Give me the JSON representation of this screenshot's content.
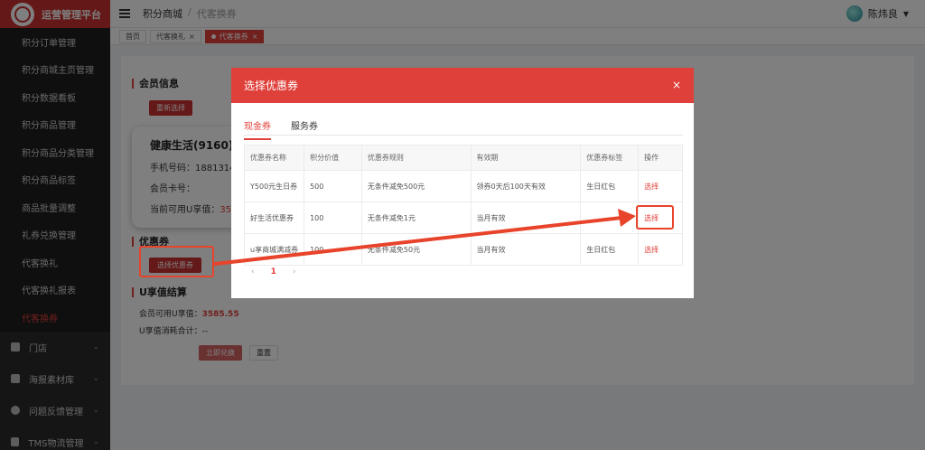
{
  "sidebar": {
    "brand_title": "运营管理平台",
    "items": [
      {
        "label": "积分订单管理"
      },
      {
        "label": "积分商城主页管理"
      },
      {
        "label": "积分数据看板"
      },
      {
        "label": "积分商品管理"
      },
      {
        "label": "积分商品分类管理"
      },
      {
        "label": "积分商品标签"
      },
      {
        "label": "商品批量调整"
      },
      {
        "label": "礼券兑换管理"
      },
      {
        "label": "代客换礼"
      },
      {
        "label": "代客换礼报表"
      },
      {
        "label": "代客换券"
      }
    ],
    "groups": [
      {
        "label": "门店"
      },
      {
        "label": "海报素材库"
      },
      {
        "label": "问题反馈管理"
      },
      {
        "label": "TMS物流管理"
      }
    ]
  },
  "header": {
    "breadcrumb_1": "积分商城",
    "breadcrumb_sep": "/",
    "breadcrumb_2": "代客换券",
    "user_name": "陈炜良"
  },
  "tags": {
    "home": "首页",
    "gift": "代客换礼",
    "coupon": "代客换券",
    "close": "×"
  },
  "main": {
    "member_info_title": "会员信息",
    "reselect_btn": "重新选择",
    "member_name": "健康生活(9160)",
    "phone_label": "手机号码：",
    "phone_value": "18813149",
    "card_label": "会员卡号：",
    "balance_label": "当前可用U享值：",
    "balance_value": "358",
    "coupon_title": "优惠券",
    "select_coupon_btn": "选择优惠券",
    "settle_title": "U享值结算",
    "settle_available_label": "会员可用U享值：",
    "settle_available_value": "3585.55",
    "settle_consume_label": "U享值消耗合计：",
    "settle_consume_value": "--",
    "redeem_btn": "立即兑换",
    "reset_btn": "重置"
  },
  "modal": {
    "title": "选择优惠券",
    "close": "×",
    "tab_cash": "现金券",
    "tab_service": "服务券",
    "columns": {
      "name": "优惠券名称",
      "points": "积分价值",
      "rule": "优惠券规则",
      "valid": "有效期",
      "tag": "优惠券标签",
      "op": "操作"
    },
    "rows": [
      {
        "name": "Y500元生日券",
        "points": "500",
        "rule": "无条件减免500元",
        "valid": "领券0天后100天有效",
        "tag": "生日红包",
        "op": "选择"
      },
      {
        "name": "好生活优惠券",
        "points": "100",
        "rule": "无条件减免1元",
        "valid": "当月有效",
        "tag": "",
        "op": "选择"
      },
      {
        "name": "u享商城满减券",
        "points": "100",
        "rule": "无条件减免50元",
        "valid": "当月有效",
        "tag": "生日红包",
        "op": "选择"
      }
    ],
    "pager": {
      "prev": "‹",
      "current": "1",
      "next": "›"
    }
  },
  "colors": {
    "brand_red": "#e0403a",
    "sidebar_bg": "#2b2b2b",
    "annotation": "#e8432b"
  }
}
